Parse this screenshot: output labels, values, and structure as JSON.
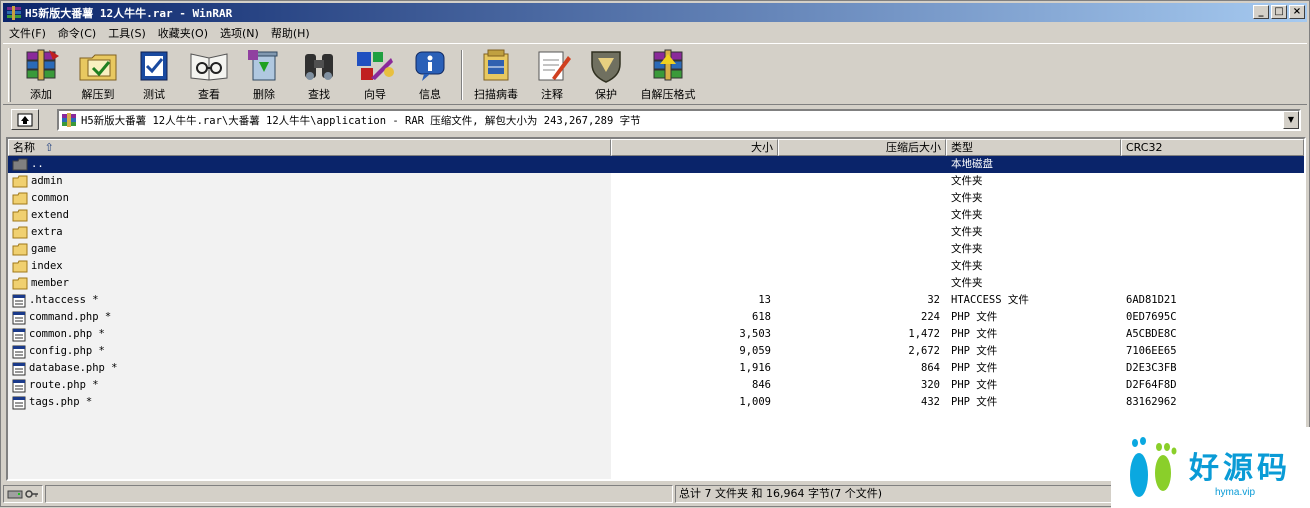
{
  "window": {
    "title": "H5新版大番薯 12人牛牛.rar - WinRAR",
    "buttons": {
      "minimize": "_",
      "maximize": "□",
      "close": "×"
    }
  },
  "menu": [
    "文件(F)",
    "命令(C)",
    "工具(S)",
    "收藏夹(O)",
    "选项(N)",
    "帮助(H)"
  ],
  "toolbar": {
    "add": "添加",
    "extract_to": "解压到",
    "test": "测试",
    "view": "查看",
    "delete": "删除",
    "find": "查找",
    "wizard": "向导",
    "info": "信息",
    "virus_scan": "扫描病毒",
    "comment": "注释",
    "protect": "保护",
    "sfx": "自解压格式"
  },
  "address": {
    "path": "H5新版大番薯 12人牛牛.rar\\大番薯 12人牛牛\\application - RAR 压缩文件, 解包大小为 243,267,289 字节"
  },
  "columns": {
    "name": "名称",
    "size": "大小",
    "packed": "压缩后大小",
    "type": "类型",
    "crc": "CRC32"
  },
  "files": [
    {
      "name": "..",
      "size": "",
      "packed": "",
      "type": "本地磁盘",
      "crc": "",
      "icon": "folder-up-icon",
      "selected": true
    },
    {
      "name": "admin",
      "size": "",
      "packed": "",
      "type": "文件夹",
      "crc": "",
      "icon": "folder-icon"
    },
    {
      "name": "common",
      "size": "",
      "packed": "",
      "type": "文件夹",
      "crc": "",
      "icon": "folder-icon"
    },
    {
      "name": "extend",
      "size": "",
      "packed": "",
      "type": "文件夹",
      "crc": "",
      "icon": "folder-icon"
    },
    {
      "name": "extra",
      "size": "",
      "packed": "",
      "type": "文件夹",
      "crc": "",
      "icon": "folder-icon"
    },
    {
      "name": "game",
      "size": "",
      "packed": "",
      "type": "文件夹",
      "crc": "",
      "icon": "folder-icon"
    },
    {
      "name": "index",
      "size": "",
      "packed": "",
      "type": "文件夹",
      "crc": "",
      "icon": "folder-icon"
    },
    {
      "name": "member",
      "size": "",
      "packed": "",
      "type": "文件夹",
      "crc": "",
      "icon": "folder-icon"
    },
    {
      "name": ".htaccess *",
      "size": "13",
      "packed": "32",
      "type": "HTACCESS 文件",
      "crc": "6AD81D21",
      "icon": "file-icon"
    },
    {
      "name": "command.php *",
      "size": "618",
      "packed": "224",
      "type": "PHP 文件",
      "crc": "0ED7695C",
      "icon": "file-icon"
    },
    {
      "name": "common.php *",
      "size": "3,503",
      "packed": "1,472",
      "type": "PHP 文件",
      "crc": "A5CBDE8C",
      "icon": "file-icon"
    },
    {
      "name": "config.php *",
      "size": "9,059",
      "packed": "2,672",
      "type": "PHP 文件",
      "crc": "7106EE65",
      "icon": "file-icon"
    },
    {
      "name": "database.php *",
      "size": "1,916",
      "packed": "864",
      "type": "PHP 文件",
      "crc": "D2E3C3FB",
      "icon": "file-icon"
    },
    {
      "name": "route.php *",
      "size": "846",
      "packed": "320",
      "type": "PHP 文件",
      "crc": "D2F64F8D",
      "icon": "file-icon"
    },
    {
      "name": "tags.php *",
      "size": "1,009",
      "packed": "432",
      "type": "PHP 文件",
      "crc": "83162962",
      "icon": "file-icon"
    }
  ],
  "status": {
    "summary": "总计 7 文件夹 和 16,964 字节(7 个文件)"
  },
  "watermark": {
    "text": "好源码",
    "url": "hyma.vip"
  },
  "colors": {
    "title_start": "#0a246a",
    "title_end": "#a6caf0",
    "selection": "#0a246a",
    "face": "#d4d0c8",
    "watermark": "#0a9bd6"
  }
}
